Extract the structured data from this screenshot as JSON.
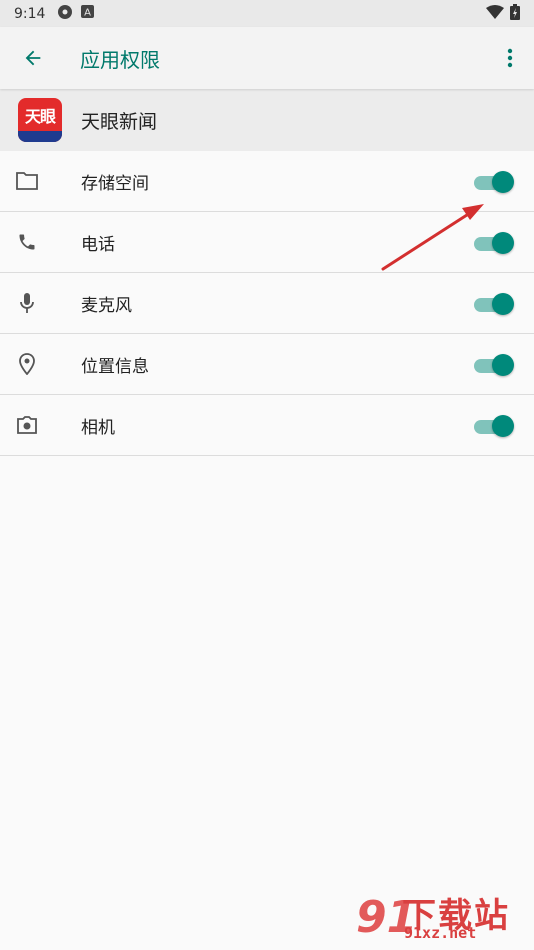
{
  "status_bar": {
    "time": "9:14",
    "icons": [
      "settings-gear-icon",
      "a-badge-icon",
      "wifi-icon",
      "battery-icon"
    ]
  },
  "app_bar": {
    "title": "应用权限",
    "back_icon": "arrow-left-icon",
    "more_icon": "more-vert-icon"
  },
  "app": {
    "name": "天眼新闻",
    "logo_text": "天眼"
  },
  "permissions": [
    {
      "label": "存储空间",
      "icon": "folder-icon",
      "enabled": true
    },
    {
      "label": "电话",
      "icon": "phone-icon",
      "enabled": true
    },
    {
      "label": "麦克风",
      "icon": "microphone-icon",
      "enabled": true
    },
    {
      "label": "位置信息",
      "icon": "location-pin-icon",
      "enabled": true
    },
    {
      "label": "相机",
      "icon": "camera-icon",
      "enabled": true
    }
  ],
  "colors": {
    "accent": "#00796b",
    "switch_on": "#00897b",
    "annotation_arrow": "#d32f2f"
  },
  "watermark": {
    "big": "下载站",
    "small": "91xz.net",
    "logo": "91"
  }
}
